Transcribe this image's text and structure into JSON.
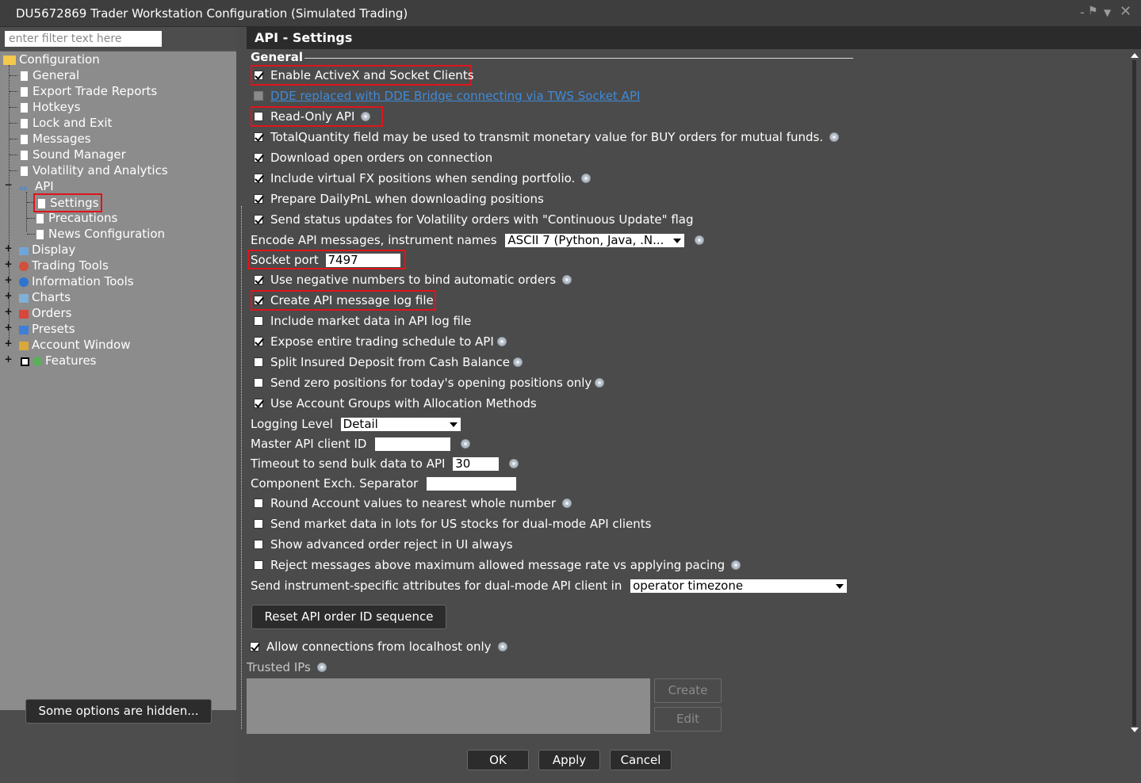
{
  "window": {
    "title": "DU5672869 Trader Workstation Configuration (Simulated Trading)"
  },
  "sidebar": {
    "filter_placeholder": "enter filter text here",
    "tree": {
      "root": "Configuration",
      "items": [
        "General",
        "Export Trade Reports",
        "Hotkeys",
        "Lock and Exit",
        "Messages",
        "Sound Manager",
        "Volatility and Analytics"
      ],
      "api": "API",
      "api_children": [
        "Settings",
        "Precautions",
        "News Configuration"
      ],
      "more": [
        "Display",
        "Trading Tools",
        "Information Tools",
        "Charts",
        "Orders",
        "Presets",
        "Account Window",
        "Features"
      ]
    },
    "hidden_options_label": "Some options are hidden..."
  },
  "panel": {
    "title": "API - Settings",
    "section": "General",
    "options": [
      {
        "label": "Enable ActiveX and Socket Clients",
        "checked": true
      },
      {
        "label": "DDE replaced with DDE Bridge connecting via TWS Socket API",
        "checked": false,
        "disabled": true
      },
      {
        "label": "Read-Only API",
        "checked": false
      },
      {
        "label": "TotalQuantity field may be used to transmit monetary value for BUY orders for mutual funds.",
        "checked": true
      },
      {
        "label": "Download open orders on connection",
        "checked": true
      },
      {
        "label": "Include virtual FX positions when sending portfolio.",
        "checked": true
      },
      {
        "label": "Prepare DailyPnL when downloading positions",
        "checked": true
      },
      {
        "label": "Send status updates for Volatility orders with \"Continuous Update\" flag",
        "checked": true
      }
    ],
    "encode_label": "Encode API messages, instrument names",
    "encode_value": "ASCII 7 (Python, Java, .N...",
    "socket_port_label": "Socket port",
    "socket_port_value": "7497",
    "options2": [
      {
        "label": "Use negative numbers to bind automatic orders",
        "checked": true
      },
      {
        "label": "Create API message log file",
        "checked": true
      },
      {
        "label": "Include market data in API log file",
        "checked": false
      },
      {
        "label": "Expose entire trading schedule to API",
        "checked": true
      },
      {
        "label": "Split Insured Deposit from Cash Balance",
        "checked": false
      },
      {
        "label": "Send zero positions for today's opening positions only",
        "checked": false
      },
      {
        "label": "Use Account Groups with Allocation Methods",
        "checked": true
      }
    ],
    "logging_level_label": "Logging Level",
    "logging_level_value": "Detail",
    "master_client_label": "Master API client ID",
    "master_client_value": "",
    "timeout_label": "Timeout to send bulk data to API",
    "timeout_value": "30",
    "separator_label": "Component Exch. Separator",
    "separator_value": "",
    "options3": [
      {
        "label": "Round Account values to nearest whole number",
        "checked": false
      },
      {
        "label": "Send market data in lots for US stocks for dual-mode API clients",
        "checked": false
      },
      {
        "label": "Show advanced order reject in UI always",
        "checked": false
      },
      {
        "label": "Reject messages above maximum allowed message rate vs applying pacing",
        "checked": false
      }
    ],
    "instrument_attr_label": "Send instrument-specific attributes for dual-mode API client in",
    "instrument_attr_value": "operator timezone",
    "reset_button": "Reset API order ID sequence",
    "localhost_label": "Allow connections from localhost only",
    "localhost_checked": true,
    "trusted_ips_label": "Trusted IPs",
    "create_button": "Create",
    "edit_button": "Edit"
  },
  "footer": {
    "ok": "OK",
    "apply": "Apply",
    "cancel": "Cancel"
  },
  "colors": {
    "background": "#4b4b4b",
    "tree_bg": "#8c8c8c",
    "highlight_red": "#e0141b",
    "link_blue": "#3f8ad8"
  }
}
